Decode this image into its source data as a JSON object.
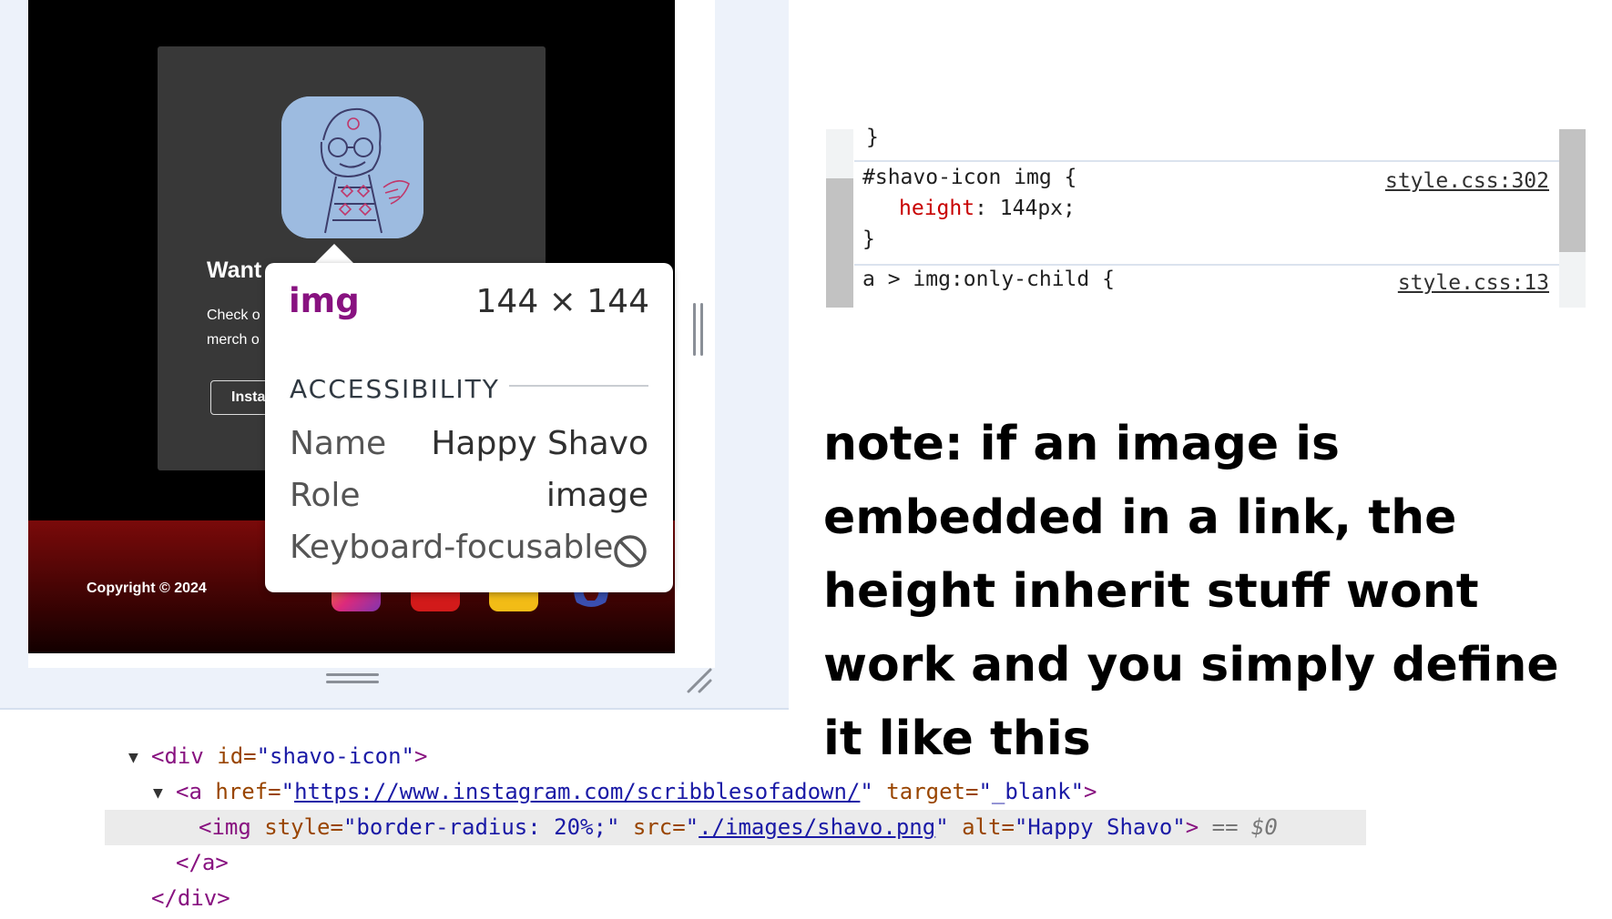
{
  "preview": {
    "card": {
      "title": "Want",
      "text": "Check o\nmerch o",
      "button_label": "Insta"
    },
    "footer": {
      "copyright": "Copyright © 2024"
    },
    "icons": [
      "instagram-icon",
      "red-social-icon",
      "yellow-social-icon",
      "github-icon"
    ]
  },
  "tooltip": {
    "tag": "img",
    "dimensions": "144 × 144",
    "section": "ACCESSIBILITY",
    "rows": [
      {
        "label": "Name",
        "value": "Happy Shavo"
      },
      {
        "label": "Role",
        "value": "image"
      },
      {
        "label": "Keyboard-focusable",
        "value": ""
      }
    ]
  },
  "styles": {
    "closing_brace": "}",
    "rule1": {
      "selector": "#shavo-icon img {",
      "source": "style.css:302",
      "property": "height",
      "value": ": 144px;",
      "close": "}"
    },
    "rule2": {
      "selector": "a > img:only-child {",
      "source": "style.css:13"
    }
  },
  "note": "note: if an image is embedded in a link, the height inherit stuff wont work and you simply define it like this",
  "dom": {
    "div_open_tag": "<div",
    "div_id_attr": " id=",
    "div_id_val": "\"shavo-icon\"",
    "div_open_end": ">",
    "a_open_tag": "<a",
    "a_href_attr": " href=",
    "a_href_q1": "\"",
    "a_href_url": "https://www.instagram.com/scribblesofadown/",
    "a_href_q2": "\"",
    "a_target_attr": " target=",
    "a_target_val": "\"_blank\"",
    "a_open_end": ">",
    "img_open_tag": "<img",
    "img_style_attr": " style=",
    "img_style_val": "\"border-radius: 20%;\"",
    "img_src_attr": " src=",
    "img_src_q1": "\"",
    "img_src_url": "./images/shavo.png",
    "img_src_q2": "\"",
    "img_alt_attr": " alt=",
    "img_alt_val": "\"Happy Shavo\"",
    "img_end": ">",
    "eq": " == ",
    "dollar": "$0",
    "a_close": "</a>",
    "div_close": "</div>"
  },
  "colors": {
    "tag": "#881280",
    "attr": "#994500",
    "value": "#1a1aa6",
    "css_property": "#c80000",
    "footer_red": "#7a0a0a"
  }
}
